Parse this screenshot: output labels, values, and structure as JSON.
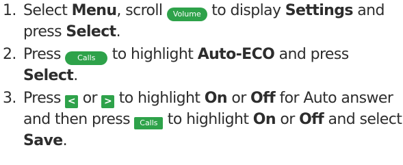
{
  "steps": [
    {
      "number": "1.",
      "t1": "Select ",
      "b1": "Menu",
      "t2": ", scroll ",
      "key1": "Volume",
      "t3": " to display ",
      "b2": "Settings",
      "t4": " and press ",
      "b3": "Select",
      "t5": "."
    },
    {
      "number": "2.",
      "t1": "Press ",
      "key1": "Calls",
      "t2": " to highlight ",
      "b1": "Auto-ECO",
      "t3": " and press ",
      "b2": "Select",
      "t4": "."
    },
    {
      "number": "3.",
      "t1": "Press ",
      "key_left": "<",
      "t2": " or ",
      "key_right": ">",
      "t3": " to highlight ",
      "b1": "On",
      "t4": " or ",
      "b2": "Off",
      "t5": " for Auto answer and then press ",
      "key1": "Calls",
      "t6": " to highlight ",
      "b3": "On",
      "t7": " or ",
      "b4": "Off",
      "t8": " and select ",
      "b5": "Save",
      "t9": "."
    }
  ],
  "colors": {
    "key_green": "#2ea24a",
    "text": "#2d2d2d"
  },
  "icons": {
    "volume_key": "volume-key-icon",
    "calls_key": "calls-key-icon",
    "left_key": "left-arrow-key-icon",
    "right_key": "right-arrow-key-icon"
  }
}
